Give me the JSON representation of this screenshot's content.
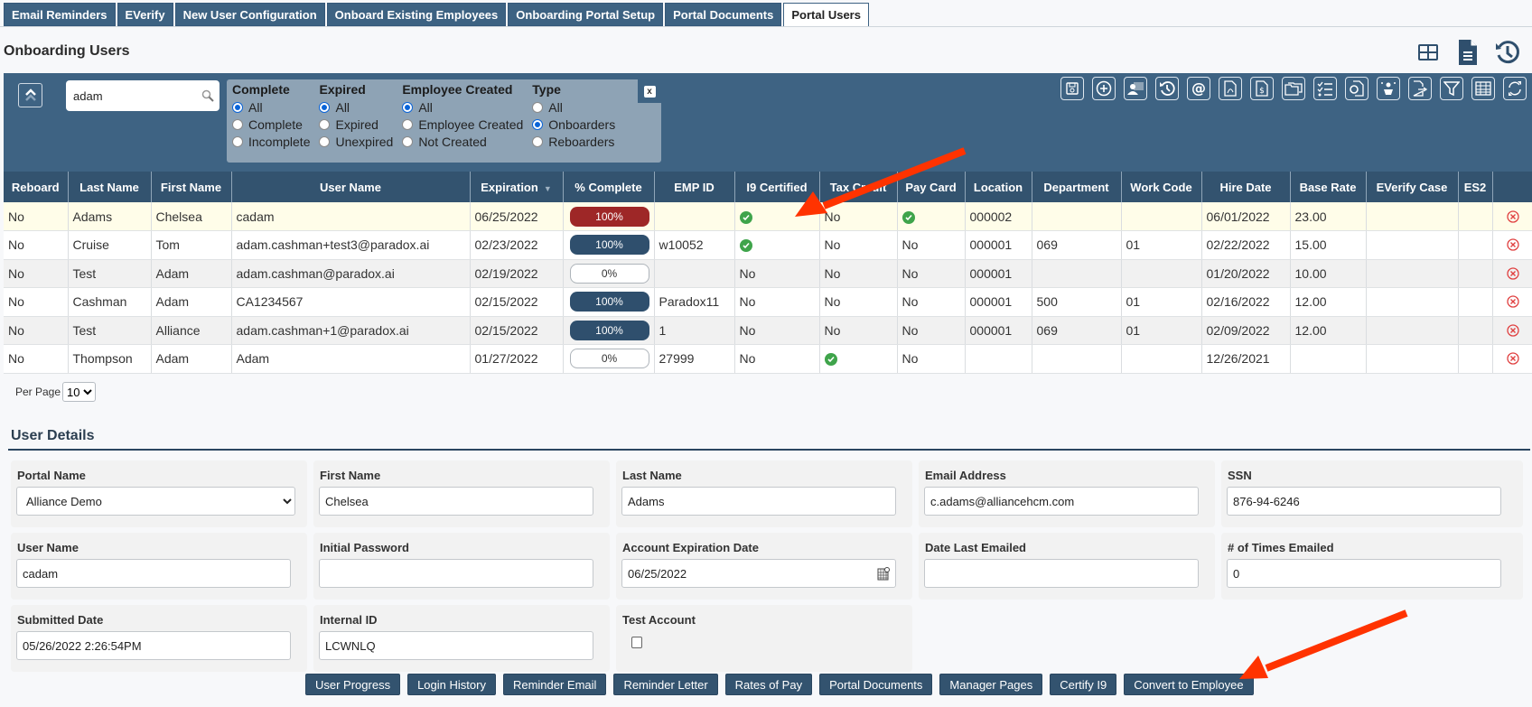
{
  "tabs": [
    {
      "label": "Email Reminders",
      "active": false
    },
    {
      "label": "EVerify",
      "active": false
    },
    {
      "label": "New User Configuration",
      "active": false
    },
    {
      "label": "Onboard Existing Employees",
      "active": false
    },
    {
      "label": "Onboarding Portal Setup",
      "active": false
    },
    {
      "label": "Portal Documents",
      "active": false
    },
    {
      "label": "Portal Users",
      "active": true
    }
  ],
  "page_title": "Onboarding Users",
  "top_icons": [
    "grid-layout-icon",
    "document-icon",
    "history-icon"
  ],
  "search": {
    "value": "adam",
    "icon": "search-icon"
  },
  "filters": {
    "groups": [
      {
        "title": "Complete",
        "options": [
          "All",
          "Complete",
          "Incomplete"
        ],
        "selected": "All"
      },
      {
        "title": "Expired",
        "options": [
          "All",
          "Expired",
          "Unexpired"
        ],
        "selected": "All"
      },
      {
        "title": "Employee Created",
        "options": [
          "All",
          "Employee Created",
          "Not Created"
        ],
        "selected": "All"
      },
      {
        "title": "Type",
        "options": [
          "All",
          "Onboarders",
          "Reboarders"
        ],
        "selected": "Onboarders"
      }
    ],
    "close_label": "x"
  },
  "toolbar_icons": [
    "save-icon",
    "add-icon",
    "user-switch-icon",
    "history-icon",
    "email-at-icon",
    "pdf-icon",
    "pay-document-icon",
    "folders-icon",
    "checklist-icon",
    "certificate-icon",
    "person-highlight-icon",
    "export-icon",
    "filter-icon",
    "table-icon",
    "refresh-icon"
  ],
  "table": {
    "columns": [
      "Reboard",
      "Last Name",
      "First Name",
      "User Name",
      "Expiration",
      "% Complete",
      "EMP ID",
      "I9 Certified",
      "Tax Credit",
      "Pay Card",
      "Location",
      "Department",
      "Work Code",
      "Hire Date",
      "Base Rate",
      "EVerify Case",
      "ES2",
      ""
    ],
    "sort_column": "Expiration",
    "rows": [
      {
        "reboard": "No",
        "last": "Adams",
        "first": "Chelsea",
        "user": "cadam",
        "exp": "06/25/2022",
        "pct": 100,
        "pct_label": "100%",
        "emp": "",
        "i9": "check",
        "tax": "No",
        "pay": "check",
        "loc": "000002",
        "dept": "",
        "work": "",
        "hire": "06/01/2022",
        "rate": "23.00",
        "everify": "",
        "es2": "",
        "selected": true
      },
      {
        "reboard": "No",
        "last": "Cruise",
        "first": "Tom",
        "user": "adam.cashman+test3@paradox.ai",
        "exp": "02/23/2022",
        "pct": 100,
        "pct_label": "100%",
        "emp": "w10052",
        "i9": "check",
        "tax": "No",
        "pay": "No",
        "loc": "000001",
        "dept": "069",
        "work": "01",
        "hire": "02/22/2022",
        "rate": "15.00",
        "everify": "",
        "es2": ""
      },
      {
        "reboard": "No",
        "last": "Test",
        "first": "Adam",
        "user": "adam.cashman@paradox.ai",
        "exp": "02/19/2022",
        "pct": 0,
        "pct_label": "0%",
        "emp": "",
        "i9": "No",
        "tax": "No",
        "pay": "No",
        "loc": "000001",
        "dept": "",
        "work": "",
        "hire": "01/20/2022",
        "rate": "10.00",
        "everify": "",
        "es2": ""
      },
      {
        "reboard": "No",
        "last": "Cashman",
        "first": "Adam",
        "user": "CA1234567",
        "exp": "02/15/2022",
        "pct": 100,
        "pct_label": "100%",
        "emp": "Paradox11",
        "i9": "No",
        "tax": "No",
        "pay": "No",
        "loc": "000001",
        "dept": "500",
        "work": "01",
        "hire": "02/16/2022",
        "rate": "12.00",
        "everify": "",
        "es2": ""
      },
      {
        "reboard": "No",
        "last": "Test",
        "first": "Alliance",
        "user": "adam.cashman+1@paradox.ai",
        "exp": "02/15/2022",
        "pct": 100,
        "pct_label": "100%",
        "emp": "1",
        "i9": "No",
        "tax": "No",
        "pay": "No",
        "loc": "000001",
        "dept": "069",
        "work": "01",
        "hire": "02/09/2022",
        "rate": "12.00",
        "everify": "",
        "es2": ""
      },
      {
        "reboard": "No",
        "last": "Thompson",
        "first": "Adam",
        "user": "Adam",
        "exp": "01/27/2022",
        "pct": 0,
        "pct_label": "0%",
        "emp": "27999",
        "i9": "No",
        "tax": "check",
        "pay": "No",
        "loc": "",
        "dept": "",
        "work": "",
        "hire": "12/26/2021",
        "rate": "",
        "everify": "",
        "es2": ""
      }
    ]
  },
  "per_page": {
    "label": "Per Page",
    "value": "10"
  },
  "user_details": {
    "title": "User Details",
    "fields": {
      "portal_name": {
        "label": "Portal Name",
        "value": "Alliance Demo"
      },
      "first_name": {
        "label": "First Name",
        "value": "Chelsea"
      },
      "last_name": {
        "label": "Last Name",
        "value": "Adams"
      },
      "email": {
        "label": "Email Address",
        "value": "c.adams@alliancehcm.com"
      },
      "ssn": {
        "label": "SSN",
        "value": "876-94-6246"
      },
      "user_name": {
        "label": "User Name",
        "value": "cadam"
      },
      "initial_password": {
        "label": "Initial Password",
        "value": ""
      },
      "account_expiration": {
        "label": "Account Expiration Date",
        "value": "06/25/2022"
      },
      "date_last_emailed": {
        "label": "Date Last Emailed",
        "value": ""
      },
      "times_emailed": {
        "label": "# of Times Emailed",
        "value": "0"
      },
      "submitted_date": {
        "label": "Submitted Date",
        "value": "05/26/2022 2:26:54PM"
      },
      "internal_id": {
        "label": "Internal ID",
        "value": "LCWNLQ"
      },
      "test_account": {
        "label": "Test Account",
        "checked": false
      }
    },
    "actions": [
      "User Progress",
      "Login History",
      "Reminder Email",
      "Reminder Letter",
      "Rates of Pay",
      "Portal Documents",
      "Manager Pages",
      "Certify I9",
      "Convert to Employee"
    ]
  },
  "colors": {
    "panel": "#3e6383",
    "header": "#33536f",
    "selected_row": "#fffde9",
    "pill_selected": "#9e2727",
    "pill_full": "#2f4f6d",
    "check": "#3fa44b",
    "delete": "#e04040",
    "annotation_arrow": "#ff3300"
  }
}
